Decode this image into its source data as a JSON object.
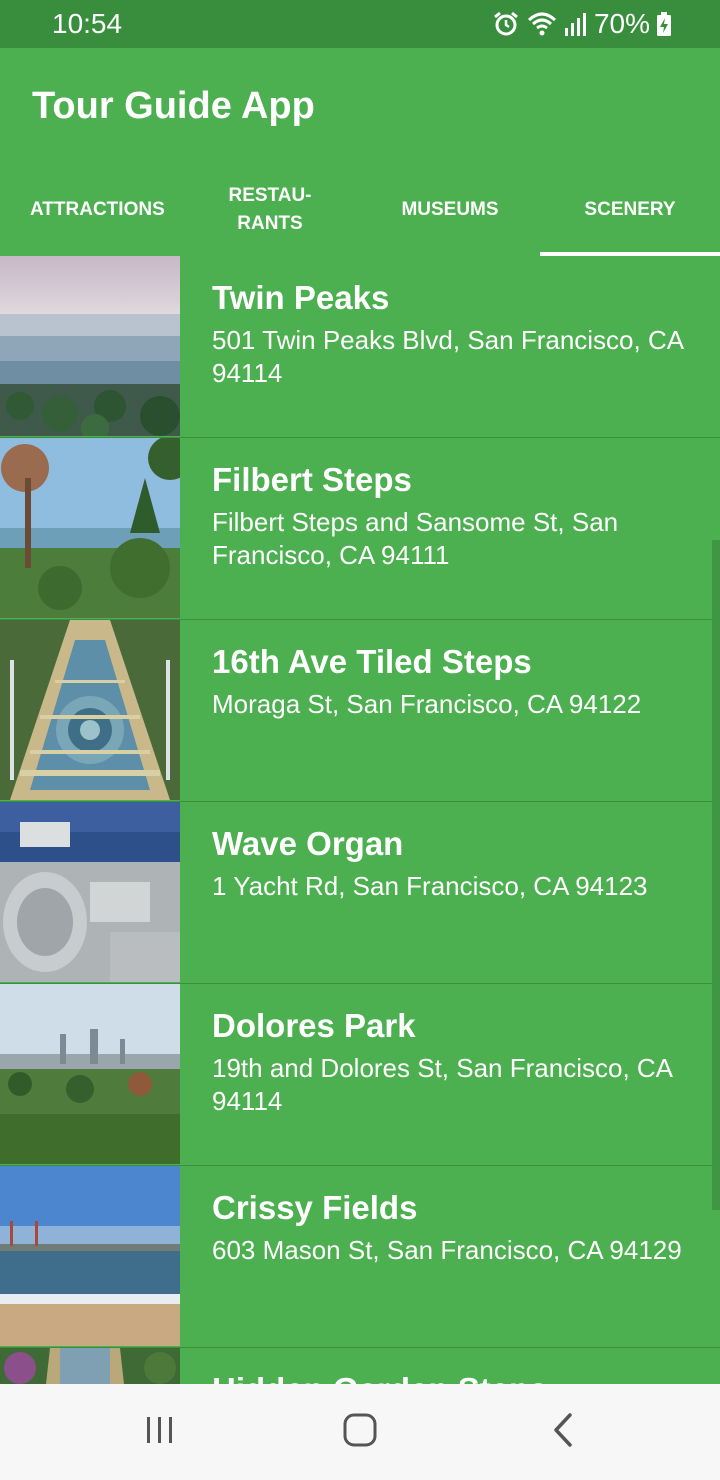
{
  "status_bar": {
    "time": "10:54",
    "battery": "70%",
    "icons": [
      "alarm-icon",
      "wifi-icon",
      "signal-icon",
      "battery-charging-icon"
    ]
  },
  "app": {
    "title": "Tour Guide App"
  },
  "tabs": [
    {
      "label": "ATTRACTIONS",
      "active": false
    },
    {
      "label": "RESTAU-\nRANTS",
      "active": false
    },
    {
      "label": "MUSEUMS",
      "active": false
    },
    {
      "label": "SCENERY",
      "active": true
    }
  ],
  "places": [
    {
      "name": "Twin Peaks",
      "address": "501 Twin Peaks Blvd, San Francisco, CA 94114"
    },
    {
      "name": "Filbert Steps",
      "address": "Filbert Steps and Sansome St, San Francisco, CA 94111"
    },
    {
      "name": "16th Ave Tiled Steps",
      "address": "Moraga St, San Francisco, CA 94122"
    },
    {
      "name": "Wave Organ",
      "address": "1 Yacht Rd, San Francisco, CA 94123"
    },
    {
      "name": "Dolores Park",
      "address": "19th and Dolores St, San Francisco, CA 94114"
    },
    {
      "name": "Crissy Fields",
      "address": "603 Mason St, San Francisco, CA 94129"
    },
    {
      "name": "Hidden Garden Steps",
      "address": ""
    }
  ],
  "colors": {
    "primary": "#4caf50",
    "primary_dark": "#388e3c",
    "text": "#ffffff",
    "nav_bar": "#f7f7f7"
  },
  "nav_bar": {
    "icons": [
      "recents-icon",
      "home-icon",
      "back-icon"
    ]
  }
}
